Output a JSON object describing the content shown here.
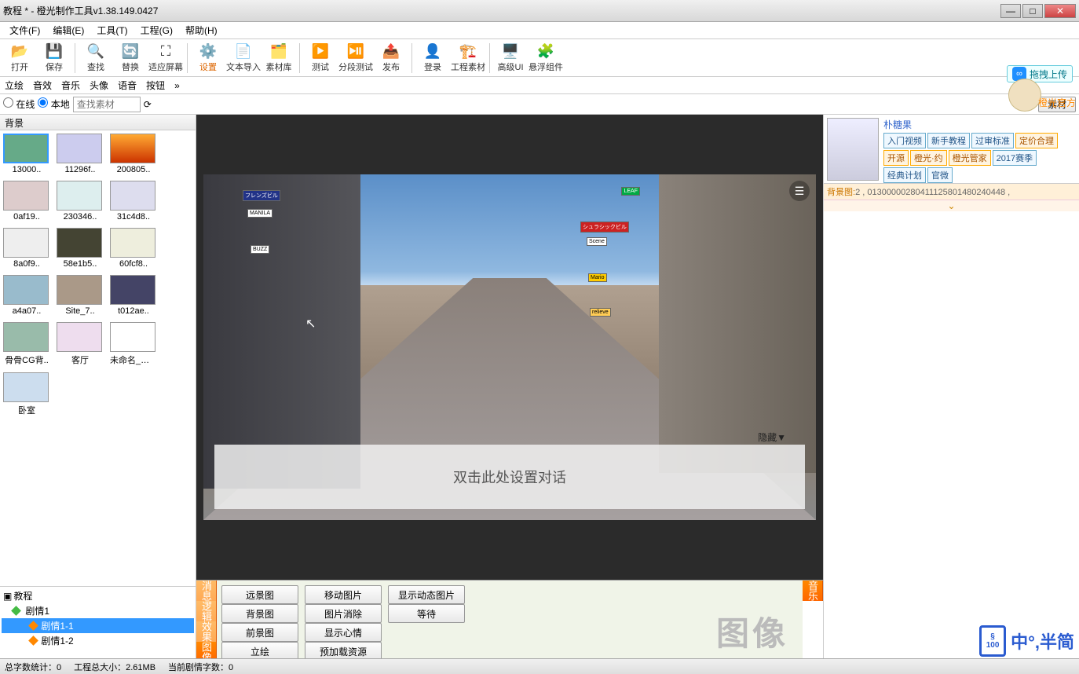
{
  "title": "教程 * - 橙光制作工具v1.38.149.0427",
  "menu": [
    "文件(F)",
    "编辑(E)",
    "工具(T)",
    "工程(G)",
    "帮助(H)"
  ],
  "toolbar": [
    {
      "icon": "📂",
      "label": "打开"
    },
    {
      "icon": "💾",
      "label": "保存"
    },
    {
      "sep": true
    },
    {
      "icon": "🔍",
      "label": "查找"
    },
    {
      "icon": "🔄",
      "label": "替换"
    },
    {
      "icon": "⛶",
      "label": "适应屏幕"
    },
    {
      "sep": true
    },
    {
      "icon": "⚙️",
      "label": "设置",
      "hl": true
    },
    {
      "icon": "📄",
      "label": "文本导入"
    },
    {
      "icon": "🗂️",
      "label": "素材库"
    },
    {
      "sep": true
    },
    {
      "icon": "▶️",
      "label": "测试"
    },
    {
      "icon": "⏯️",
      "label": "分段测试"
    },
    {
      "icon": "📤",
      "label": "发布"
    },
    {
      "sep": true
    },
    {
      "icon": "👤",
      "label": "登录"
    },
    {
      "icon": "🏗️",
      "label": "工程素材"
    },
    {
      "sep": true
    },
    {
      "icon": "🖥️",
      "label": "高级UI"
    },
    {
      "icon": "🧩",
      "label": "悬浮组件"
    }
  ],
  "subTabs": [
    "立绘",
    "音效",
    "音乐",
    "头像",
    "语音",
    "按钮",
    "»"
  ],
  "searchRow": {
    "online": "在线",
    "local": "本地",
    "placeholder": "查找素材",
    "button": "素材"
  },
  "assetHeader": "背景",
  "assets": [
    {
      "label": "13000..",
      "bg": "#6a8",
      "sel": true
    },
    {
      "label": "11296f..",
      "bg": "#cce"
    },
    {
      "label": "200805..",
      "bg": "linear-gradient(#fa3,#c30)"
    },
    {
      "label": "0af19..",
      "bg": "#dcc"
    },
    {
      "label": "230346..",
      "bg": "#dee"
    },
    {
      "label": "31c4d8..",
      "bg": "#dde"
    },
    {
      "label": "8a0f9..",
      "bg": "#eee"
    },
    {
      "label": "58e1b5..",
      "bg": "#443"
    },
    {
      "label": "60fcf8..",
      "bg": "#eed"
    },
    {
      "label": "a4a07..",
      "bg": "#9bc"
    },
    {
      "label": "Site_7..",
      "bg": "#a98"
    },
    {
      "label": "t012ae..",
      "bg": "#446"
    },
    {
      "label": "骨骨CG背..",
      "bg": "#9ba"
    },
    {
      "label": "客厅",
      "bg": "#ede"
    },
    {
      "label": "未命名_副本..",
      "bg": "#fff"
    },
    {
      "label": "卧室",
      "bg": "#cde"
    }
  ],
  "tree": {
    "root": "教程",
    "ch": "剧情1",
    "leaves": [
      "剧情1-1",
      "剧情1-2"
    ],
    "selected": "剧情1-1"
  },
  "canvas": {
    "dialogHint": "双击此处设置对话",
    "hide": "隐藏▼"
  },
  "bottomTabs": [
    "消息",
    "逻辑",
    "效果",
    "图像"
  ],
  "bottomTabsRight": [
    "音乐"
  ],
  "bottomBgText": "图像",
  "bottomButtons": [
    [
      "远景图",
      "移动图片",
      "显示动态图片"
    ],
    [
      "背景图",
      "图片消除",
      "等待"
    ],
    [
      "前景图",
      "显示心情"
    ],
    [
      "立绘",
      "预加载资源"
    ]
  ],
  "upload": "拖拽上传",
  "brand": "橙光官方",
  "user": {
    "name": "朴糖果",
    "tagsBlue": [
      "入门视频",
      "新手教程",
      "过审标准"
    ],
    "tagsOrange1": [
      "定价合理"
    ],
    "tagsOrange2": [
      "开源",
      "橙光·约",
      "橙光管家"
    ],
    "tagsBlue2": [
      "2017赛季"
    ],
    "tagsBlue3": [
      "经典计划",
      "官微"
    ]
  },
  "bgIdRow": {
    "key": "背景图:",
    "val": "2 , 01300000280411125801480240448 ,"
  },
  "status": {
    "wordCount": "总字数统计：0",
    "projSize": "工程总大小：2.61MB",
    "curWords": "当前剧情字数：0"
  },
  "watermark": {
    "num": "100",
    "text": "中°,半简"
  }
}
